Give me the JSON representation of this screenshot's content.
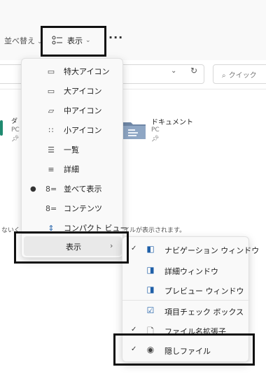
{
  "toolbar": {
    "sort_label": "並べ替え",
    "view_label": "表示",
    "more_label": "···"
  },
  "address": {
    "search_placeholder": "クイック"
  },
  "content": {
    "left_item_name": "ダ",
    "left_item_sub": "PC",
    "doc_item_name": "ドキュメント",
    "doc_item_sub": "PC",
    "hint_left": "ないく",
    "hint_right": "イルが表示されます。"
  },
  "view_menu": {
    "items": [
      {
        "label": "特大アイコン",
        "icon": "extra-large-icons-icon",
        "selected": false
      },
      {
        "label": "大アイコン",
        "icon": "large-icons-icon",
        "selected": false
      },
      {
        "label": "中アイコン",
        "icon": "medium-icons-icon",
        "selected": false
      },
      {
        "label": "小アイコン",
        "icon": "small-icons-icon",
        "selected": false
      },
      {
        "label": "一覧",
        "icon": "list-icon",
        "selected": false
      },
      {
        "label": "詳細",
        "icon": "details-icon",
        "selected": false
      },
      {
        "label": "並べて表示",
        "icon": "tiles-icon",
        "selected": true
      },
      {
        "label": "コンテンツ",
        "icon": "content-icon",
        "selected": false
      },
      {
        "label": "コンパクト ビュー",
        "icon": "compact-view-icon",
        "selected": false
      }
    ],
    "show_label": "表示",
    "show_arrow": "›"
  },
  "show_submenu": {
    "items": [
      {
        "label": "ナビゲーション ウィンドウ",
        "icon": "navigation-pane-icon",
        "checked": true
      },
      {
        "label": "詳細ウィンドウ",
        "icon": "details-pane-icon",
        "checked": false
      },
      {
        "label": "プレビュー ウィンドウ",
        "icon": "preview-pane-icon",
        "checked": false
      },
      {
        "label": "項目チェック ボックス",
        "icon": "item-checkbox-icon",
        "checked": false
      },
      {
        "label": "ファイル名拡張子",
        "icon": "file-extension-icon",
        "checked": true
      },
      {
        "label": "隠しファイル",
        "icon": "hidden-files-icon",
        "checked": true
      }
    ]
  },
  "colors": {
    "menu_bg": "#f9f9f9",
    "accent": "#1f5fa8",
    "highlight_border": "#111111"
  }
}
